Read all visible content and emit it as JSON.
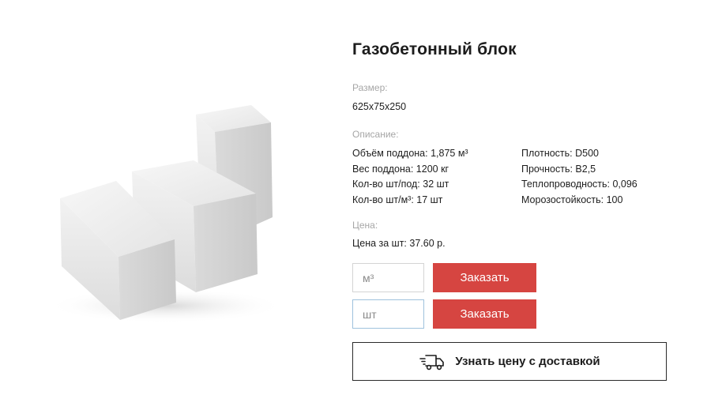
{
  "product": {
    "title": "Газобетонный блок",
    "image_icon": "aerated-concrete-blocks"
  },
  "size": {
    "label": "Размер:",
    "value": "625x75x250"
  },
  "description": {
    "label": "Описание:",
    "left": [
      "Объём поддона: 1,875 м³",
      "Вес поддона: 1200 кг",
      "Кол-во шт/под: 32 шт",
      "Кол-во шт/м³: 17 шт"
    ],
    "right": [
      "Плотность: D500",
      "Прочность: B2,5",
      "Теплопроводность: 0,096",
      "Морозостойкость: 100"
    ]
  },
  "price": {
    "label": "Цена:",
    "value": "Цена за шт: 37.60 р."
  },
  "order": {
    "m3_placeholder": "м³",
    "pcs_placeholder": "шт",
    "button_label": "Заказать"
  },
  "delivery": {
    "label": "Узнать цену с доставкой",
    "icon": "delivery-truck-icon"
  },
  "colors": {
    "accent": "#d64541",
    "title": "#1c1c1c",
    "label_gray": "#a6a6a6",
    "active_border": "#9fc2dd"
  }
}
